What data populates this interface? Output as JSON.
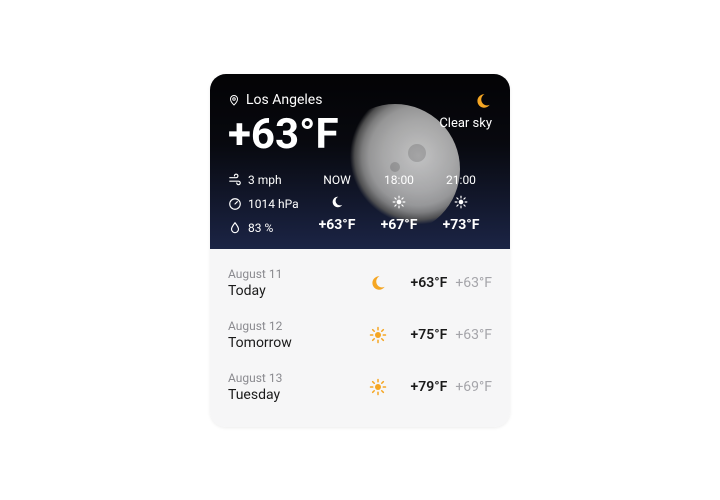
{
  "location": {
    "name": "Los Angeles"
  },
  "current": {
    "temp": "+63°F",
    "condition": "Clear sky",
    "icon": "moon"
  },
  "stats": {
    "wind": "3 mph",
    "pressure": "1014 hPa",
    "humidity": "83 %"
  },
  "hourly": [
    {
      "label": "NOW",
      "icon": "moon",
      "temp": "+63°F"
    },
    {
      "label": "18:00",
      "icon": "sun",
      "temp": "+67°F"
    },
    {
      "label": "21:00",
      "icon": "sun",
      "temp": "+73°F"
    }
  ],
  "daily": [
    {
      "date": "August 11",
      "name": "Today",
      "icon": "moon",
      "hi": "+63°F",
      "lo": "+63°F"
    },
    {
      "date": "August 12",
      "name": "Tomorrow",
      "icon": "sun",
      "hi": "+75°F",
      "lo": "+63°F"
    },
    {
      "date": "August 13",
      "name": "Tuesday",
      "icon": "sun",
      "hi": "+79°F",
      "lo": "+69°F"
    }
  ],
  "colors": {
    "accent": "#f5a623"
  }
}
